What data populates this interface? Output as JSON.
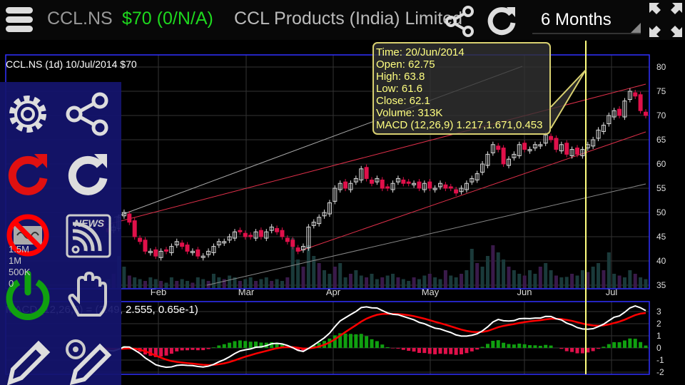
{
  "header": {
    "symbol": "CCL.NS",
    "price": "$70 (0/N/A)",
    "company": "CCL Products (India) Limited",
    "period": "6 Months"
  },
  "chart_title": "CCL.NS (1d) 10/Jul/2014 $70",
  "macd_label": "MACD (12,26,9) = (2.49, 2.555, 0.65e-1)",
  "tooltip": {
    "time": "Time: 20/Jun/2014",
    "open": "Open: 62.75",
    "high": "High: 63.8",
    "low": "Low: 61.6",
    "close": "Close: 62.1",
    "volume": "Volume: 313K",
    "macd": "MACD (12,26,9) 1.217,1.671,0.453"
  },
  "volume_labels": [
    "1.5M",
    "1M",
    "500K",
    "0"
  ],
  "colors": {
    "up": "#dddddd",
    "down": "#e0104a",
    "border": "#3030ff",
    "crosshair": "#ffff80",
    "macd": "#ffffff",
    "signal": "#ff0000"
  },
  "chart_data": {
    "type": "candlestick",
    "price_ticks": [
      80,
      75,
      70,
      65,
      60,
      55,
      50,
      45,
      40,
      35
    ],
    "price_range": [
      35,
      80
    ],
    "macd_ticks": [
      3,
      2,
      1,
      0,
      -1,
      -2
    ],
    "macd_range": [
      -2,
      3.5
    ],
    "months": [
      "Feb",
      "Mar",
      "Apr",
      "May",
      "Jun",
      "Jul"
    ],
    "closes": [
      48,
      47,
      46,
      47,
      49,
      50,
      48,
      45,
      44,
      42,
      42,
      41,
      42,
      42,
      43,
      44,
      43,
      42,
      42,
      41,
      41,
      42,
      43,
      44,
      44,
      45,
      46,
      46,
      45,
      45,
      46,
      45,
      46,
      47,
      46,
      45,
      44,
      43,
      42,
      43,
      47,
      48,
      49,
      50,
      52,
      55,
      56,
      55,
      56,
      57,
      59,
      57,
      56,
      57,
      55,
      55,
      56,
      57,
      56,
      56,
      56,
      55,
      56,
      55,
      55,
      56,
      55,
      55,
      54,
      55,
      56,
      57,
      58,
      60,
      62,
      64,
      63,
      60,
      61,
      62,
      64,
      63,
      63,
      64,
      64,
      66,
      65,
      63,
      64,
      62,
      63,
      62,
      63,
      64,
      65,
      67,
      68,
      70,
      71,
      70,
      73,
      75,
      74,
      71,
      70
    ],
    "volumes_k": [
      300,
      200,
      250,
      400,
      900,
      600,
      350,
      300,
      250,
      200,
      300,
      250,
      200,
      150,
      300,
      200,
      250,
      200,
      150,
      300,
      250,
      200,
      400,
      300,
      250,
      350,
      300,
      200,
      250,
      300,
      200,
      250,
      300,
      200,
      250,
      200,
      300,
      1400,
      800,
      600,
      1200,
      900,
      700,
      500,
      400,
      600,
      700,
      300,
      400,
      500,
      350,
      300,
      400,
      250,
      300,
      350,
      400,
      300,
      250,
      200,
      300,
      250,
      350,
      400,
      300,
      250,
      500,
      350,
      300,
      400,
      500,
      1100,
      700,
      600,
      900,
      1200,
      1000,
      800,
      600,
      500,
      400,
      350,
      500,
      400,
      600,
      700,
      500,
      350,
      300,
      313,
      400,
      350,
      500,
      450,
      600,
      700,
      500,
      1000,
      400,
      350,
      300,
      500,
      400,
      300,
      250
    ]
  },
  "left_panel": {
    "items": [
      "settings",
      "share",
      "refresh-red",
      "refresh",
      "no-indicator",
      "news",
      "power",
      "hand",
      "pencil",
      "pencil-gear"
    ]
  }
}
